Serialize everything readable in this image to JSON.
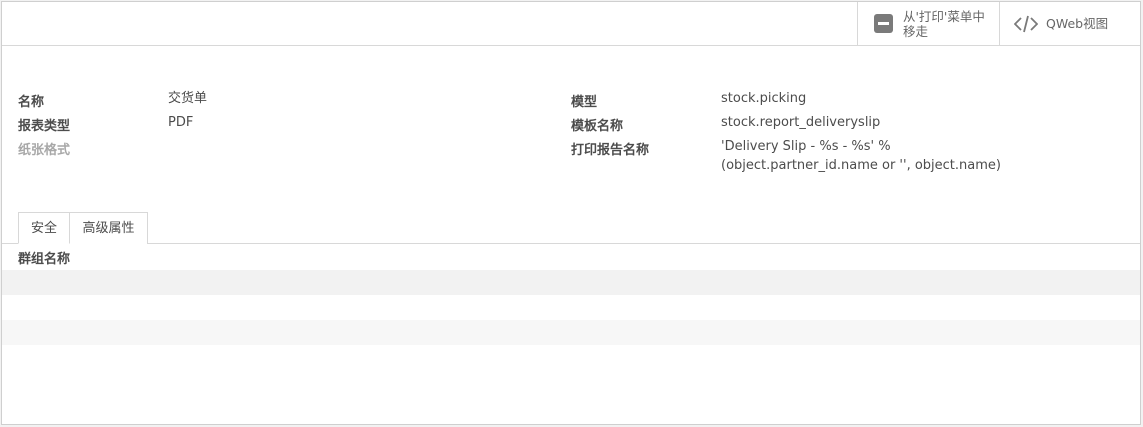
{
  "buttons": {
    "unlink_label": "从'打印'菜单中移走",
    "qweb_label": "QWeb视图"
  },
  "fields": {
    "name_label": "名称",
    "name_value": "交货单",
    "report_type_label": "报表类型",
    "report_type_value": "PDF",
    "paper_format_label": "纸张格式",
    "model_label": "模型",
    "model_value": "stock.picking",
    "template_label": "模板名称",
    "template_value": "stock.report_deliveryslip",
    "print_name_label": "打印报告名称",
    "print_name_value": "'Delivery Slip - %s - %s' % (object.partner_id.name or '', object.name)"
  },
  "tabs": [
    {
      "label": "安全"
    },
    {
      "label": "高级属性"
    }
  ],
  "groups_table": {
    "column_header": "群组名称"
  }
}
